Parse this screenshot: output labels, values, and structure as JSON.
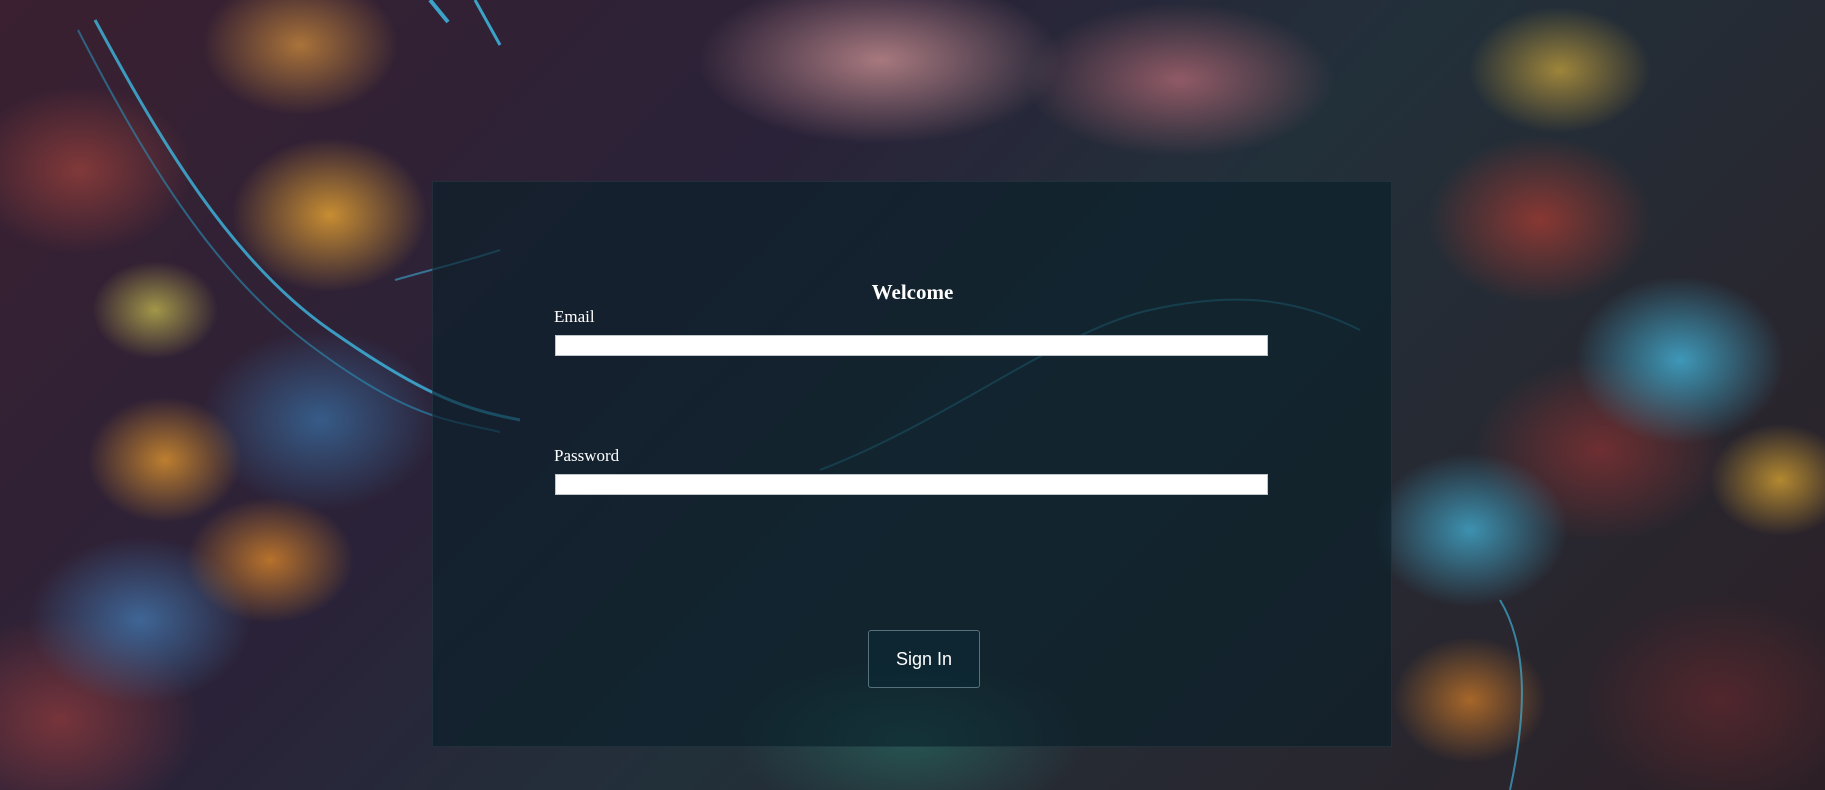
{
  "form": {
    "title": "Welcome",
    "email_label": "Email",
    "email_value": "",
    "password_label": "Password",
    "password_value": "",
    "submit_label": "Sign In"
  },
  "colors": {
    "overlay": "#081e28",
    "text": "#ffffff",
    "field_background": "#ffffff",
    "road_light": "#3fc3ee"
  },
  "background": {
    "image": "aerial-autumn-forest-with-road"
  }
}
